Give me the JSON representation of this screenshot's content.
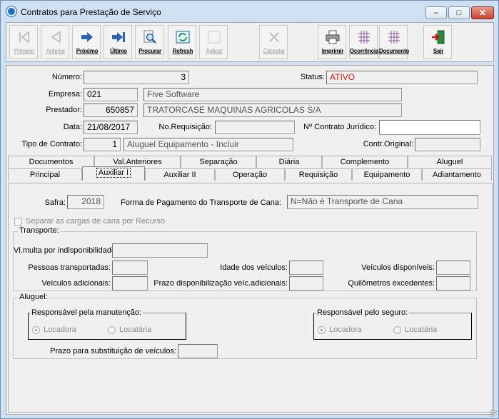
{
  "window": {
    "title": "Contratos para Prestação de Serviço"
  },
  "toolbar": {
    "buttons": [
      {
        "label": "Primeiro",
        "enabled": false,
        "icon": "first-arrow-icon"
      },
      {
        "label": "Anterior",
        "enabled": false,
        "icon": "previous-arrow-icon"
      },
      {
        "label": "Próximo",
        "enabled": true,
        "icon": "next-arrow-icon"
      },
      {
        "label": "Último",
        "enabled": true,
        "icon": "last-arrow-icon"
      },
      {
        "label": "Procurar",
        "enabled": true,
        "icon": "search-icon"
      },
      {
        "label": "Refresh",
        "enabled": true,
        "icon": "refresh-icon"
      },
      {
        "label": "Aplicar",
        "enabled": false,
        "icon": "apply-icon"
      },
      {
        "label": "Cancelar",
        "enabled": false,
        "icon": "cancel-icon"
      },
      {
        "label": "Imprimir",
        "enabled": true,
        "icon": "printer-icon"
      },
      {
        "label": "Ocorrência",
        "enabled": true,
        "icon": "grid-icon"
      },
      {
        "label": "Documento",
        "enabled": true,
        "icon": "grid-icon"
      },
      {
        "label": "Sair",
        "enabled": true,
        "icon": "exit-door-icon"
      }
    ]
  },
  "header": {
    "numero": {
      "label": "Número:",
      "value": "3"
    },
    "status": {
      "label": "Status:",
      "value": "ATIVO"
    },
    "empresa": {
      "label": "Empresa:",
      "code": "021",
      "name": "Five Software"
    },
    "prestador": {
      "label": "Prestador:",
      "code": "650857",
      "name": "TRATORCASE MAQUINAS AGRICOLAS S/A"
    },
    "data": {
      "label": "Data:",
      "value": "21/08/2017"
    },
    "requisicao": {
      "label": "No.Requisição:",
      "value": ""
    },
    "contrato_juridico": {
      "label": "Nº Contrato Jurídico:",
      "value": ""
    },
    "tipo_contrato": {
      "label": "Tipo de Contrato:",
      "code": "1",
      "name": "Aluguel Equipamento - Incluir"
    },
    "contr_original": {
      "label": "Contr.Original:",
      "value": ""
    }
  },
  "tabs": {
    "row_top": [
      "Documentos",
      "Val.Anteriores",
      "Separação",
      "Diária",
      "Complemento",
      "Aluguel"
    ],
    "row_bottom": [
      "Principal",
      "Auxiliar I",
      "Auxiliar II",
      "Operação",
      "Requisição",
      "Equipamento",
      "Adiantamento"
    ],
    "active": "Auxiliar I"
  },
  "auxiliar1": {
    "safra": {
      "label": "Safra:",
      "value": "2018"
    },
    "forma_pagamento": {
      "label": "Forma de Pagamento do Transporte de Cana:",
      "value": "N=Não é Transporte de Cana"
    },
    "separar_cargas": {
      "label": "Separar as cargas de cana por Recurso",
      "checked": false
    },
    "transporte": {
      "title": "Transporte:",
      "vl_multa": {
        "label": "Vl.multa por indisponibilidade:",
        "value": ""
      },
      "pessoas": {
        "label": "Pessoas transportadas:",
        "value": ""
      },
      "idade": {
        "label": "Idade dos veículos:",
        "value": ""
      },
      "veic_disponiveis": {
        "label": "Veículos disponíveis:",
        "value": ""
      },
      "veic_adicionais": {
        "label": "Veículos adicionais:",
        "value": ""
      },
      "prazo_disp": {
        "label": "Prazo disponibilização veíc.adicionais:",
        "value": ""
      },
      "km_excedentes": {
        "label": "Quilômetros excedentes:",
        "value": ""
      }
    },
    "aluguel": {
      "title": "Aluguel:",
      "manutencao": {
        "title": "Responsável pela manutenção:",
        "options": [
          "Locadora",
          "Locatária"
        ],
        "selected": "Locadora"
      },
      "seguro": {
        "title": "Responsável pelo seguro:",
        "options": [
          "Locadora",
          "Locatária"
        ],
        "selected": "Locadora"
      },
      "prazo_substituicao": {
        "label": "Prazo para substituição de veículos:",
        "value": ""
      }
    }
  }
}
